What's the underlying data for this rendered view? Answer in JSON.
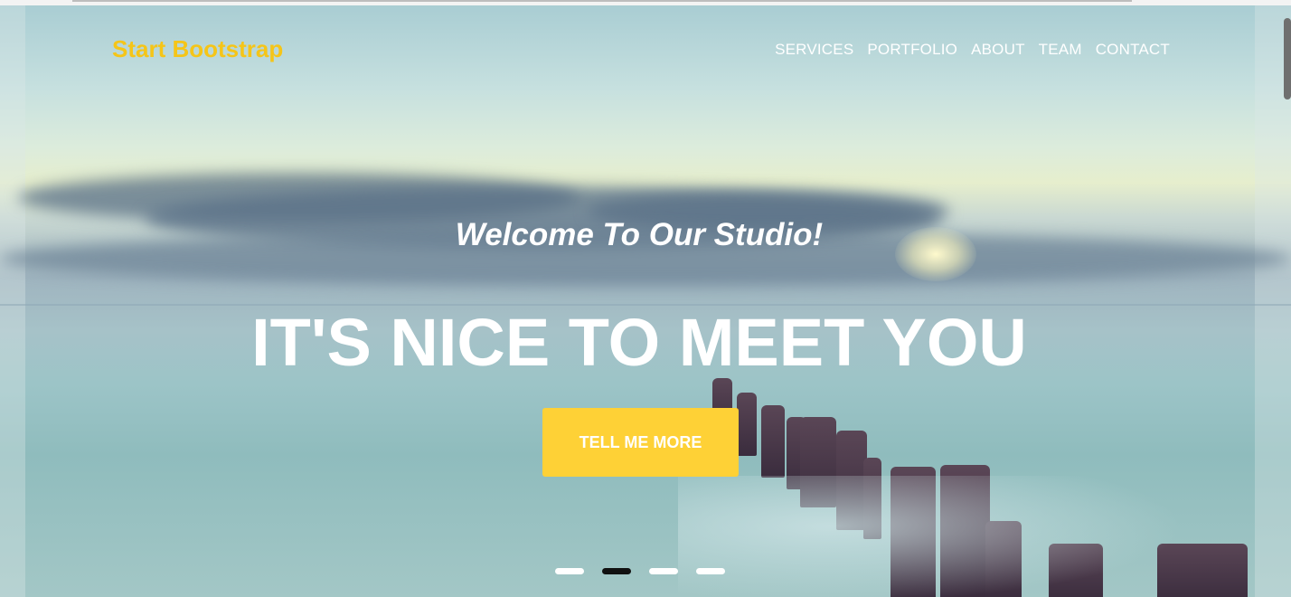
{
  "brand": {
    "name": "Start Bootstrap",
    "color": "#f5c518"
  },
  "nav": {
    "items": [
      "SERVICES",
      "PORTFOLIO",
      "ABOUT",
      "TEAM",
      "CONTACT"
    ]
  },
  "hero": {
    "subheading": "Welcome To Our Studio!",
    "heading": "IT'S NICE TO MEET YOU",
    "cta_label": "TELL ME MORE",
    "cta_color": "#fed136"
  },
  "carousel": {
    "slide_count": 4,
    "active_index": 1
  }
}
